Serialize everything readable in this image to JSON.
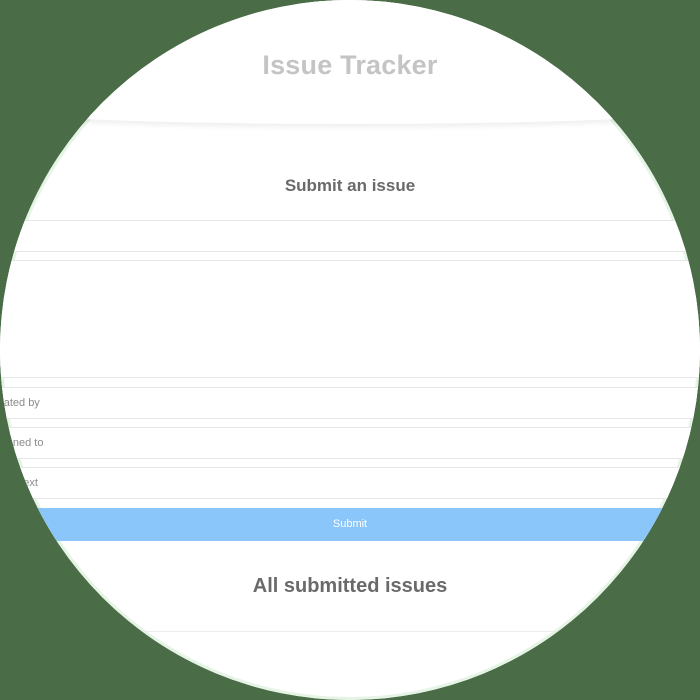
{
  "app": {
    "title": "Issue Tracker"
  },
  "form": {
    "heading": "Submit an issue",
    "fields": {
      "title_placeholder": "",
      "description_placeholder": "",
      "created_by_placeholder": "Created by",
      "assigned_to_placeholder": "Assigned to",
      "status_placeholder": "Status text"
    },
    "submit_label": "Submit"
  },
  "issues": {
    "heading": "All submitted issues"
  },
  "colors": {
    "submit_button": "#8ac6fa",
    "title_text": "#c4c4c4",
    "heading_text": "#6a6a6a",
    "outer_background": "#4a6d48"
  }
}
